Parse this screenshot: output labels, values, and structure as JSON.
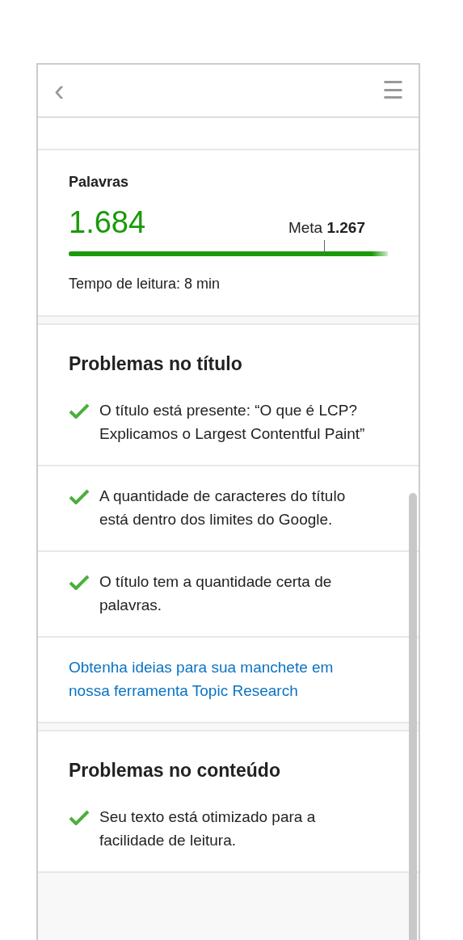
{
  "header": {
    "back_icon": "‹",
    "menu_icon": "☰"
  },
  "words": {
    "title": "Palavras",
    "count": "1.684",
    "goal_label": "Meta",
    "goal_value": "1.267",
    "level": 1,
    "reading_time": "Tempo de leitura: 8 min"
  },
  "sections": [
    {
      "title": "Problemas no título",
      "items": [
        {
          "kind": "check",
          "text": "O título está presente: “O que é LCP? Explicamos o Largest Contentful Paint”"
        },
        {
          "kind": "check",
          "text": "A quantidade de caracteres do título está dentro dos limites do Google."
        },
        {
          "kind": "check",
          "text": "O título tem a quantidade certa de palavras."
        },
        {
          "kind": "link",
          "text": "Obtenha ideias para sua manchete em nossa ferramenta Topic Research"
        }
      ]
    },
    {
      "title": "Problemas no conteúdo",
      "items": [
        {
          "kind": "check",
          "text": "Seu texto está otimizado para a facilidade de leitura."
        }
      ]
    }
  ]
}
